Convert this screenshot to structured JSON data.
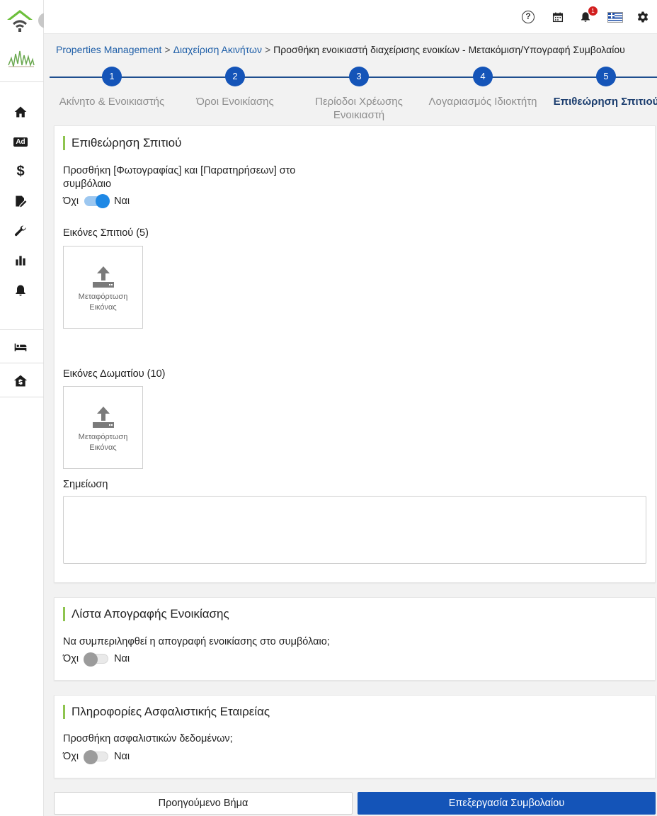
{
  "colors": {
    "primary": "#1454b8",
    "link": "#1f5fa8",
    "accent_bar": "#8ec44f",
    "notification": "#d21f1f"
  },
  "sidebar": {
    "collapse_icon": "chevron-right-icon",
    "items": [
      {
        "name": "home",
        "icon": "home-icon"
      },
      {
        "name": "ads",
        "icon": "ad-icon",
        "label": "Ad"
      },
      {
        "name": "finance",
        "icon": "dollar-icon",
        "label": "$"
      },
      {
        "name": "contracts",
        "icon": "edit-document-icon"
      },
      {
        "name": "maintenance",
        "icon": "wrench-icon"
      },
      {
        "name": "reports",
        "icon": "bar-chart-icon"
      },
      {
        "name": "notifications",
        "icon": "bell-icon"
      },
      {
        "name": "rooms",
        "icon": "bed-icon"
      },
      {
        "name": "rent-home",
        "icon": "home-dollar-icon"
      }
    ]
  },
  "topbar": {
    "notification_count": "1",
    "icons": [
      "help-icon",
      "calendar-icon",
      "bell-icon",
      "greek-flag-icon",
      "gear-icon"
    ],
    "help_glyph": "?"
  },
  "breadcrumb": {
    "items": [
      "Properties Management",
      "Διαχείριση Ακινήτων"
    ],
    "separator": ">",
    "current": "Προσθήκη ενοικιαστή διαχείρισης ενοικίων - Μετακόμιση/Υπογραφή Συμβολαίου"
  },
  "stepper": {
    "steps": [
      {
        "number": "1",
        "label": "Ακίνητο & Ενοικιαστής"
      },
      {
        "number": "2",
        "label": "Όροι Ενοικίασης"
      },
      {
        "number": "3",
        "label": "Περίοδοι Χρέωσης Ενοικιαστή"
      },
      {
        "number": "4",
        "label": "Λογαριασμός Ιδιοκτήτη"
      },
      {
        "number": "5",
        "label": "Επιθεώρηση Σπιτιού"
      }
    ],
    "active_step": 5
  },
  "inspection": {
    "title": "Επιθεώρηση Σπιτιού",
    "add_photos_question": "Προσθήκη [Φωτογραφίας] και [Παρατηρήσεων] στο συμβόλαιο",
    "toggle": {
      "off_label": "Όχι",
      "on_label": "Ναι",
      "value": true
    },
    "house_images_label": "Εικόνες Σπιτιού (5)",
    "room_images_label": "Εικόνες Δωματίου (10)",
    "upload_label": "Μεταφόρτωση Εικόνας",
    "note_label": "Σημείωση",
    "note_value": ""
  },
  "inventory": {
    "title": "Λίστα Απογραφής Ενοικίασης",
    "question": "Να συμπεριληφθεί η απογραφή ενοικίασης στο συμβόλαιο;",
    "toggle": {
      "off_label": "Όχι",
      "on_label": "Ναι",
      "value": false
    }
  },
  "insurance": {
    "title": "Πληροφορίες Ασφαλιστικής Εταιρείας",
    "question": "Προσθήκη ασφαλιστικών δεδομένων;",
    "toggle": {
      "off_label": "Όχι",
      "on_label": "Ναι",
      "value": false
    }
  },
  "actions": {
    "previous_label": "Προηγούμενο Βήμα",
    "next_label": "Επεξεργασία Συμβολαίου"
  }
}
